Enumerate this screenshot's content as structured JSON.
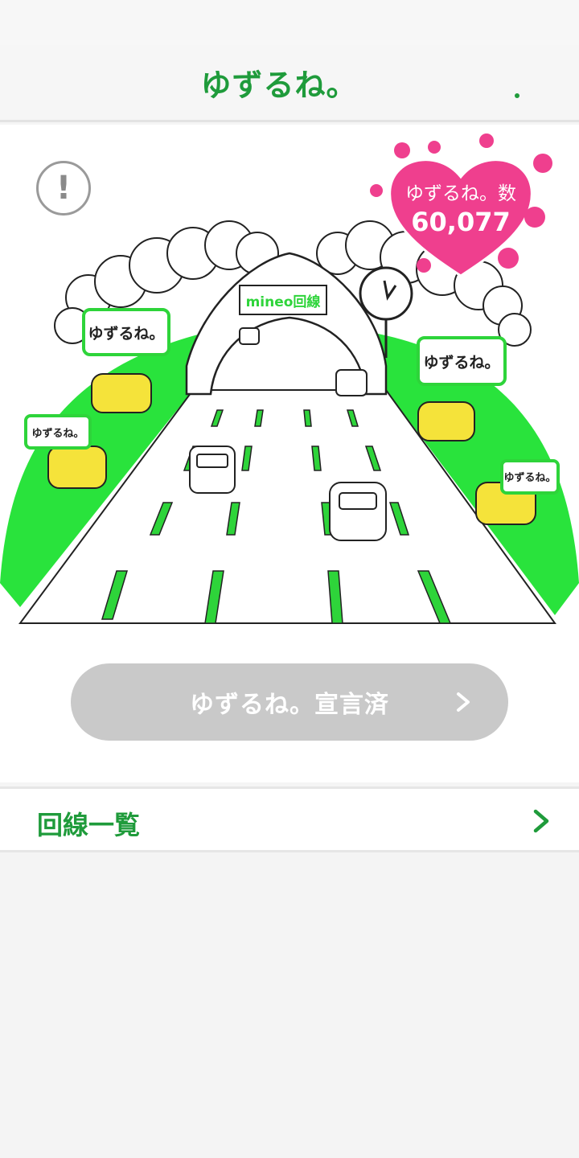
{
  "header": {
    "title": "ゆずるね。"
  },
  "counter": {
    "label": "ゆずるね。数",
    "value": "60,077"
  },
  "illustration": {
    "sign": "mineo回線",
    "bubble_text": "ゆずるね。"
  },
  "declare_button": {
    "label": "ゆずるね。宣言済"
  },
  "lines_row": {
    "label": "回線一覧"
  },
  "colors": {
    "brand_green": "#1f9b3b",
    "grass_green": "#29e33c",
    "heart_pink": "#ef3f8e",
    "button_gray": "#c9c9c9"
  },
  "icons": {
    "info": "exclamation-circle-icon",
    "declare_arrow": "chevron-right-icon",
    "row_arrow": "chevron-right-icon"
  }
}
